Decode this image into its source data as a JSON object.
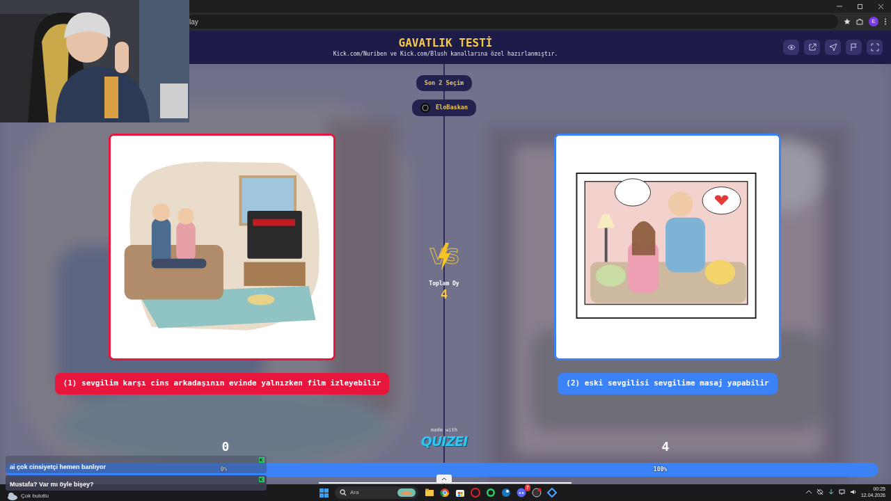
{
  "browser": {
    "address": "lay",
    "profile": "E"
  },
  "header": {
    "title": "GAVATLIK TESTİ",
    "subtitle": "Kick.com/Nuriben ve Kick.com/Blush kanallarına özel hazırlanmıştır."
  },
  "pills": {
    "history": "Son 2 Seçim",
    "user": "EloBaskan"
  },
  "versus": {
    "logo": "VS",
    "label": "Toplam Oy",
    "total": "4"
  },
  "options": [
    {
      "label": "(1) sevgilim karşı cins arkadaşının evinde yalnızken film izleyebilir",
      "color": "#e8163c",
      "score": "0",
      "percent": "0%",
      "level": 0
    },
    {
      "label": "(2) eski sevgilisi sevgilime masaj yapabilir",
      "color": "#3b82f6",
      "score": "4",
      "percent": "100%",
      "level": 1
    }
  ],
  "footer": {
    "made_with": "made with",
    "logo": "QUIZEI"
  },
  "dock": {
    "expanded": false
  },
  "chat": [
    {
      "text": "ai çok cinsiyetçi hemen banlıyor"
    },
    {
      "text": "Mustafa? Var mı öyle bişey?"
    }
  ],
  "taskbar": {
    "weather": "Çok bulutlu",
    "search_placeholder": "Ara",
    "badge": "7",
    "time": "00:25",
    "date": "12.04.2026"
  }
}
